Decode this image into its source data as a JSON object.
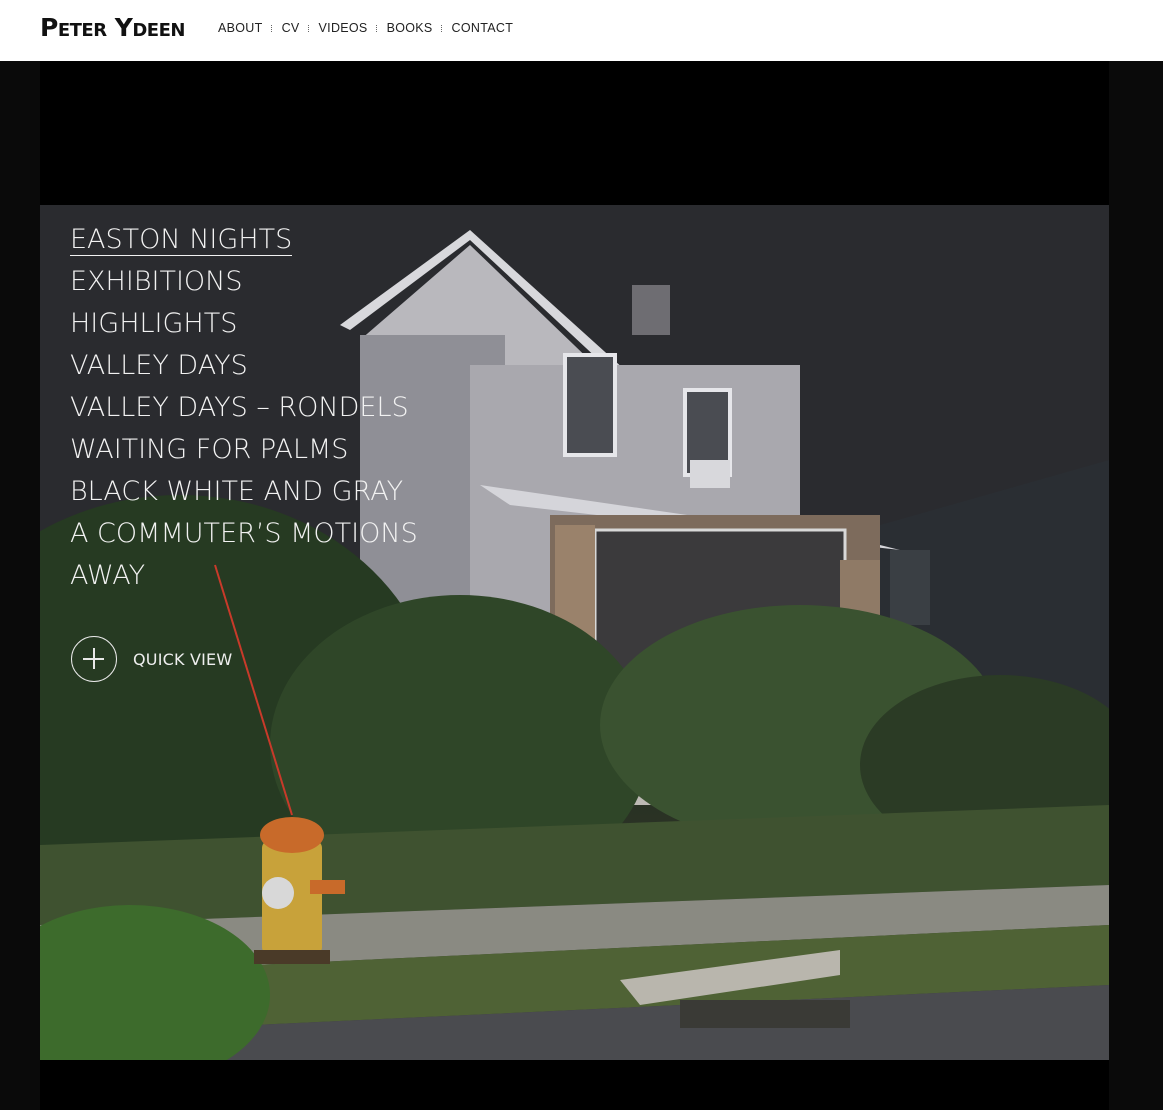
{
  "header": {
    "logo": "Peter Ydeen",
    "nav": [
      "ABOUT",
      "CV",
      "VIDEOS",
      "BOOKS",
      "CONTACT"
    ]
  },
  "series_menu": {
    "items": [
      "EASTON NIGHTS",
      "EXHIBITIONS",
      "HIGHLIGHTS",
      "VALLEY DAYS",
      "VALLEY DAYS – RONDELS",
      "WAITING FOR PALMS",
      "BLACK WHITE AND GRAY",
      "A COMMUTER’S MOTIONS",
      "AWAY"
    ],
    "active": "EASTON NIGHTS"
  },
  "quick_view": {
    "label": "QUICK VIEW",
    "icon": "plus-circle-icon"
  },
  "colors": {
    "header_bg": "#ffffff",
    "page_bg": "#0a0a0a",
    "stage_bg": "#000000",
    "menu_text": "#f2f2f2"
  }
}
